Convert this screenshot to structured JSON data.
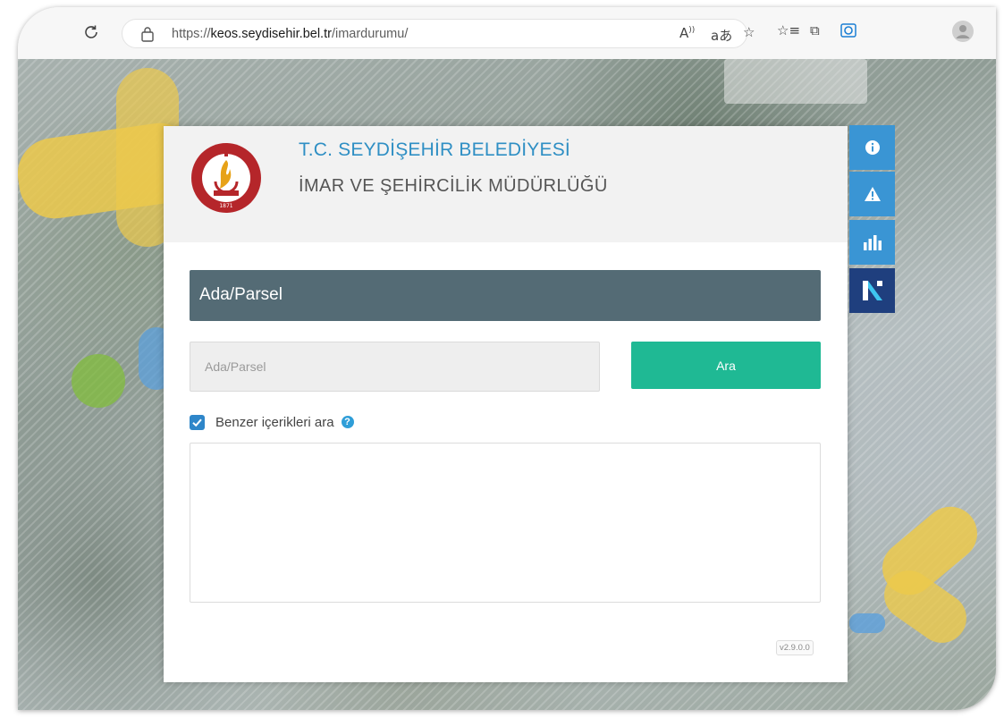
{
  "browser": {
    "url_prefix": "https://",
    "url_domain": "keos.seydisehir.bel.tr",
    "url_path": "/imardurumu/"
  },
  "header": {
    "title": "T.C. SEYDİŞEHİR BELEDİYESİ",
    "subtitle": "İMAR VE ŞEHİRCİLİK MÜDÜRLÜĞÜ",
    "logo_text_top": "SEYDİŞEHİR BELEDİYE BAŞKANLIĞI",
    "logo_year": "1871"
  },
  "search": {
    "section_title": "Ada/Parsel",
    "placeholder": "Ada/Parsel",
    "value": "",
    "button_label": "Ara",
    "similar_label": "Benzer içerikleri ara",
    "similar_checked": true
  },
  "footer": {
    "version": "v2.9.0.0"
  },
  "side_toolbar": {
    "icons": [
      "info-icon",
      "warning-icon",
      "bar-chart-icon",
      "netcad-logo-icon"
    ]
  },
  "colors": {
    "title_blue": "#2f8fc4",
    "section_bar": "#546b75",
    "search_button": "#1fb994",
    "side_button": "#3a95d4",
    "brand_button": "#1f3f7e"
  }
}
